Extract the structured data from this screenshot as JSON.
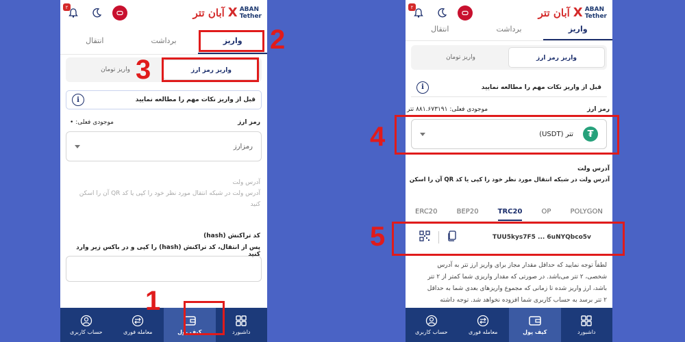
{
  "brand": {
    "fa": "آبان تتر",
    "en_line1": "ABAN",
    "en_line2": "Tether",
    "x": "X"
  },
  "notification_count": "۲",
  "tabs": [
    "واریز",
    "برداشت",
    "انتقال"
  ],
  "segment": [
    "واریز رمز ارز",
    "واریز تومان"
  ],
  "notice": "قبل از واریز نکات مهم را مطالعه نمایید",
  "info_glyph": "i",
  "left": {
    "crypto_label": "رمز ارز",
    "balance_label": "موجودی فعلی:",
    "balance_bullet": "•",
    "select_placeholder": "رمزارز",
    "wallet_title": "آدرس ولت",
    "wallet_hint_1": "آدرس ولت در شبکه انتقال مورد نظر خود را کپی یا کد QR آن را اسکن",
    "wallet_hint_2": "کنید",
    "hash_title": "کد تراکنش (hash)",
    "hash_hint": "پس از انتقال، کد تراکنش (hash) را کپی و در باکس زیر وارد کنید"
  },
  "right": {
    "crypto_label": "رمز ارز",
    "balance_label": "موجودی فعلی:",
    "balance_value": "۸۸۱.۶۷۳۱۹۱",
    "balance_unit": "تتر",
    "selected_coin": "تتر (USDT)",
    "tether_glyph": "₮",
    "wallet_title": "آدرس ولت",
    "wallet_hint": "آدرس ولت در شبکه انتقال مورد نظر خود را کپی یا کد QR آن را اسکن",
    "networks": [
      "ERC20",
      "BEP20",
      "TRC20",
      "OP",
      "POLYGON"
    ],
    "active_network": "TRC20",
    "address": "TUU5kys7F5 ... 6uNYQbco5v",
    "warning_1": "لطفاً توجه نمایید که حداقل مقدار مجاز برای واریز ارز تتر به آدرس",
    "warning_2": "شخصی، ۲ تتر می‌باشد. در صورتی که مقدار واریزی شما کمتر از ۲ تتر",
    "warning_3": "باشد، ارز واریز شده تا زمانی که مجموع واریزهای بعدی شما به حداقل",
    "warning_4": "۲ تتر برسد به حساب کاربری شما افزوده نخواهد شد. توجه داشته"
  },
  "nav": [
    "داشبورد",
    "کیف پول",
    "معامله فوری",
    "حساب کاربری"
  ],
  "steps": [
    "1",
    "2",
    "3",
    "4",
    "5"
  ],
  "colors": {
    "accent": "#1a2d6b",
    "nav": "#1c3a7a",
    "annotation": "#e01b1b",
    "background": "#4a63c5"
  }
}
